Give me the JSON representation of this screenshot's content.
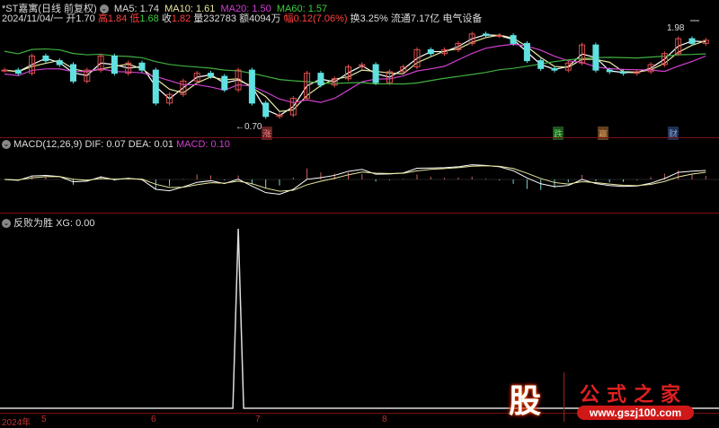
{
  "header": {
    "title": "*ST嘉寓(日线 前复权)",
    "ma5": "MA5: 1.74",
    "ma10": "MA10: 1.61",
    "ma20": "MA20: 1.50",
    "ma60": "MA60: 1.57",
    "date": "2024/11/04/一",
    "open": "开1.70",
    "high_l": "高",
    "high": "1.84",
    "low_l": "低",
    "low": "1.68",
    "close_l": "收",
    "close": "1.82",
    "vol": "量232783",
    "amt": "额4094万",
    "chg_l": "幅",
    "chg": "0.12(7.06%)",
    "turn": "换3.25%",
    "float": "流通7.17亿",
    "sector": "电气设备"
  },
  "annotations": {
    "high_price": "1.98",
    "low_price": "←0.70",
    "tag_zhang": "涨",
    "tag_die": "跌",
    "tag_ying": "赢",
    "tag_cai": "财"
  },
  "macd": {
    "title": "MACD(12,26,9)",
    "dif": "DIF: 0.07",
    "dea": "DEA: 0.01",
    "macd": "MACD: 0.10"
  },
  "xg": {
    "title": "反败为胜",
    "value": "XG: 0.00"
  },
  "axis": {
    "year": "2024年",
    "months": [
      "5",
      "6",
      "7",
      "8"
    ]
  },
  "watermark": {
    "logo": "股",
    "name": "公式之家",
    "url": "www.gszj100.com"
  },
  "colors": {
    "up": "#e05050",
    "down": "#60e0e0",
    "ma5": "#ffffff",
    "ma10": "#e8e8a0",
    "ma20": "#d040d0",
    "ma60": "#40b040"
  },
  "chart_data": {
    "type": "candlestick",
    "closes": [
      1.43,
      1.39,
      1.61,
      1.55,
      1.5,
      1.29,
      1.43,
      1.61,
      1.39,
      1.52,
      1.43,
      1.01,
      1.12,
      1.29,
      1.39,
      1.35,
      1.18,
      1.43,
      1.01,
      0.84,
      0.86,
      1.07,
      1.39,
      1.24,
      1.32,
      1.47,
      1.5,
      1.27,
      1.41,
      1.47,
      1.69,
      1.64,
      1.69,
      1.77,
      1.89,
      1.87,
      1.87,
      1.77,
      1.55,
      1.45,
      1.43,
      1.52,
      1.75,
      1.43,
      1.41,
      1.39,
      1.41,
      1.5,
      1.64,
      1.83,
      1.77,
      1.81
    ],
    "xg_spike_index": 17,
    "price_range": [
      0.7,
      1.98
    ]
  }
}
